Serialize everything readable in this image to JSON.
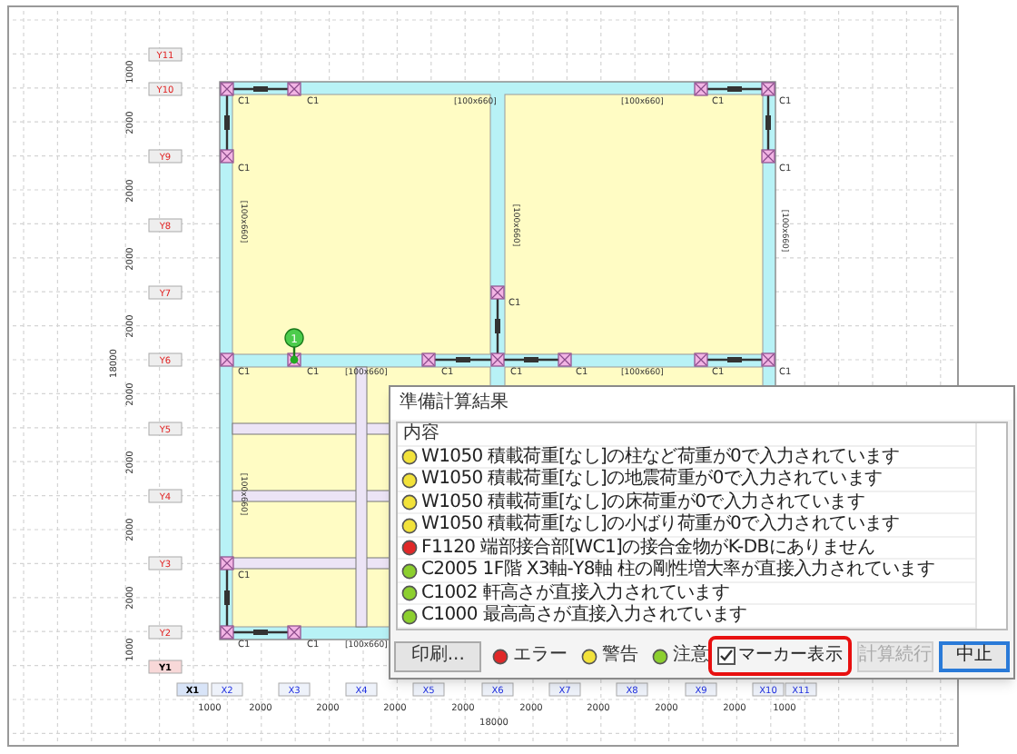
{
  "plan": {
    "y_axis": [
      {
        "label": "Y11",
        "selected": false
      },
      {
        "label": "Y10",
        "selected": false
      },
      {
        "label": "Y9",
        "selected": false
      },
      {
        "label": "Y8",
        "selected": false
      },
      {
        "label": "Y7",
        "selected": false
      },
      {
        "label": "Y6",
        "selected": false
      },
      {
        "label": "Y5",
        "selected": false
      },
      {
        "label": "Y4",
        "selected": false
      },
      {
        "label": "Y3",
        "selected": false
      },
      {
        "label": "Y2",
        "selected": false
      },
      {
        "label": "Y1",
        "selected": true
      }
    ],
    "x_axis": [
      {
        "label": "X1",
        "selected": true
      },
      {
        "label": "X2",
        "selected": false
      },
      {
        "label": "X3",
        "selected": false
      },
      {
        "label": "X4",
        "selected": false
      },
      {
        "label": "X5",
        "selected": false
      },
      {
        "label": "X6",
        "selected": false
      },
      {
        "label": "X7",
        "selected": false
      },
      {
        "label": "X8",
        "selected": false
      },
      {
        "label": "X9",
        "selected": false
      },
      {
        "label": "X10",
        "selected": false
      },
      {
        "label": "X11",
        "selected": false
      }
    ],
    "y_dimensions": [
      "1000",
      "2000",
      "2000",
      "2000",
      "2000",
      "2000",
      "2000",
      "2000",
      "2000",
      "1000"
    ],
    "x_dimensions": [
      "1000",
      "2000",
      "2000",
      "2000",
      "2000",
      "2000",
      "2000",
      "2000",
      "2000",
      "1000"
    ],
    "y_total": "18000",
    "x_total": "18000",
    "column_labels": [
      "C1",
      "C1",
      "C1",
      "C1",
      "C1",
      "C1",
      "C1",
      "C1",
      "C1",
      "C1",
      "C1",
      "C1",
      "C1",
      "C1",
      "C1",
      "C1",
      "C1"
    ],
    "member_labels": [
      "[100x660]",
      "[100x660]",
      "[100x660]",
      "[100x660]",
      "[100x660]",
      "[100x660]",
      "[100x660]",
      "[100x660]",
      "[100x660]"
    ],
    "marker": "1"
  },
  "dialog": {
    "title": "準備計算結果",
    "column": "内容",
    "results": [
      {
        "kind": "warning",
        "text": "W1050 積載荷重[なし]の柱など荷重が0で入力されています"
      },
      {
        "kind": "warning",
        "text": "W1050 積載荷重[なし]の地震荷重が0で入力されています"
      },
      {
        "kind": "warning",
        "text": "W1050 積載荷重[なし]の床荷重が0で入力されています"
      },
      {
        "kind": "warning",
        "text": "W1050 積載荷重[なし]の小ばり荷重が0で入力されています"
      },
      {
        "kind": "error",
        "text": "F1120 端部接合部[WC1]の接合金物がK-DBにありません"
      },
      {
        "kind": "caution",
        "text": "C2005 1F階 X3軸-Y8軸 柱の剛性増大率が直接入力されています"
      },
      {
        "kind": "caution",
        "text": "C1002 軒高さが直接入力されています"
      },
      {
        "kind": "caution",
        "text": "C1000 最高高さが直接入力されています"
      }
    ],
    "print_button": {
      "label": "印刷..."
    },
    "legend": [
      {
        "kind": "error",
        "label": "エラー"
      },
      {
        "kind": "warning",
        "label": "警告"
      },
      {
        "kind": "caution",
        "label": "注意"
      }
    ],
    "marker_checkbox": {
      "label": "マーカー表示",
      "checked": true,
      "highlighted": true
    },
    "buttons": [
      {
        "label": "計算続行",
        "disabled": true,
        "default": false
      },
      {
        "label": "中止",
        "disabled": false,
        "default": true
      }
    ]
  }
}
